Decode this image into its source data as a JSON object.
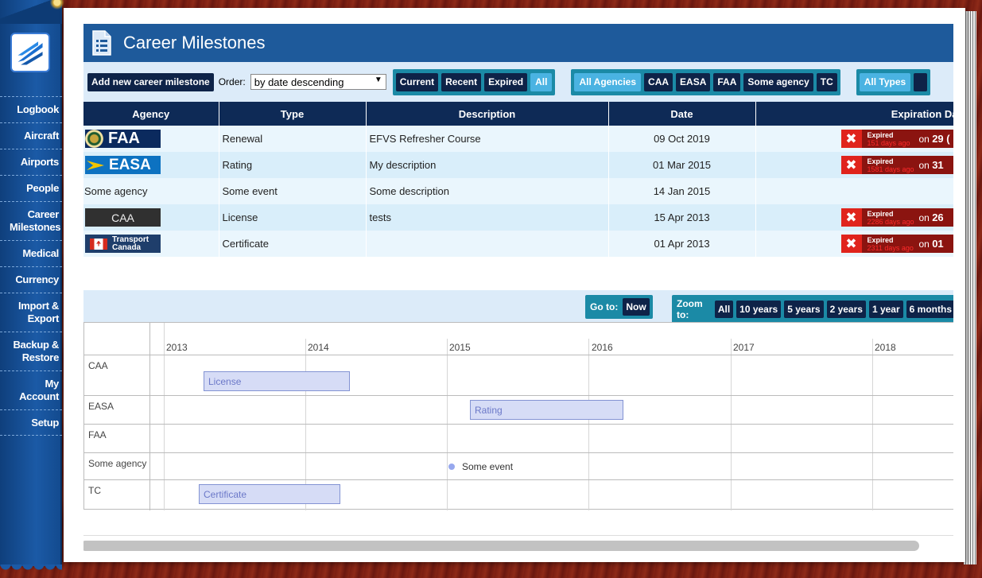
{
  "sidebar": {
    "items": [
      {
        "label": "Logbook"
      },
      {
        "label": "Aircraft"
      },
      {
        "label": "Airports"
      },
      {
        "label": "People"
      },
      {
        "label": "Career Milestones"
      },
      {
        "label": "Medical"
      },
      {
        "label": "Currency"
      },
      {
        "label": "Import & Export"
      },
      {
        "label": "Backup & Restore"
      },
      {
        "label": "My Account"
      },
      {
        "label": "Setup"
      }
    ]
  },
  "header": {
    "title": "Career Milestones",
    "icon": "document-icon"
  },
  "toolbar": {
    "add_label": "Add new career milestone",
    "order_label": "Order:",
    "order_value": "by date descending",
    "status_filters": [
      "Current",
      "Recent",
      "Expired",
      "All"
    ],
    "status_active": "All",
    "agency_filters": [
      "All Agencies",
      "CAA",
      "EASA",
      "FAA",
      "Some agency",
      "TC"
    ],
    "agency_active": "All Agencies",
    "type_filters": [
      "All Types"
    ]
  },
  "table": {
    "columns": [
      "Agency",
      "Type",
      "Description",
      "Date",
      "Expiration Da"
    ],
    "rows": [
      {
        "agency": "FAA",
        "logo": "faa",
        "type": "Renewal",
        "description": "EFVS Refresher Course",
        "date": "09 Oct 2019",
        "expired": true,
        "status": "Expired",
        "ago": "151 days ago",
        "on_label": "on",
        "on_date": "29 ("
      },
      {
        "agency": "EASA",
        "logo": "easa",
        "type": "Rating",
        "description": "My description",
        "date": "01 Mar 2015",
        "expired": true,
        "status": "Expired",
        "ago": "1581 days ago",
        "on_label": "on",
        "on_date": "31"
      },
      {
        "agency": "Some agency",
        "logo": "",
        "type": "Some event",
        "description": "Some description",
        "date": "14 Jan 2015",
        "expired": false
      },
      {
        "agency": "CAA",
        "logo": "caa",
        "type": "License",
        "description": "tests",
        "date": "15 Apr 2013",
        "expired": true,
        "status": "Expired",
        "ago": "2286 days ago",
        "on_label": "on",
        "on_date": "26"
      },
      {
        "agency": "Transport Canada",
        "logo": "tc",
        "type": "Certificate",
        "description": "",
        "date": "01 Apr 2013",
        "expired": true,
        "status": "Expired",
        "ago": "2311 days ago",
        "on_label": "on",
        "on_date": "01"
      }
    ]
  },
  "timeline": {
    "goto_label": "Go to:",
    "goto_now": "Now",
    "zoom_label": "Zoom to:",
    "zoom_options": [
      "All",
      "10 years",
      "5 years",
      "2 years",
      "1 year",
      "6 months"
    ],
    "years": [
      "2013",
      "2014",
      "2015",
      "2016",
      "2017",
      "2018"
    ],
    "groups": [
      "CAA",
      "EASA",
      "FAA",
      "Some agency",
      "TC"
    ],
    "items": [
      {
        "group": "CAA",
        "label": "License",
        "kind": "range"
      },
      {
        "group": "EASA",
        "label": "Rating",
        "kind": "range"
      },
      {
        "group": "Some agency",
        "label": "Some event",
        "kind": "point"
      },
      {
        "group": "TC",
        "label": "Certificate",
        "kind": "range"
      }
    ]
  },
  "colors": {
    "accent": "#1e5a9b",
    "dark_button": "#0e2348",
    "filter_group": "#1b8aa6",
    "expired": "#8b1410"
  }
}
